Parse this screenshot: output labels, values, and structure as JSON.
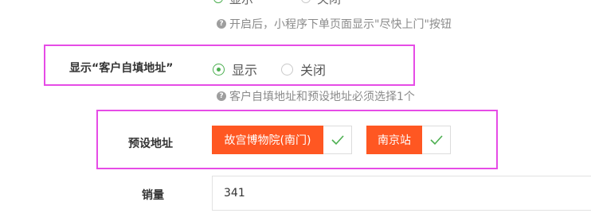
{
  "top_radios": {
    "options": [
      "显示",
      "关闭"
    ]
  },
  "hint_quick_visit": "开启后，小程序下单页面显示\"尽快上门\"按钮",
  "show_customer_address": {
    "label": "显示“客户自填地址”",
    "options": [
      {
        "label": "显示",
        "checked": true
      },
      {
        "label": "关闭",
        "checked": false
      }
    ]
  },
  "hint_address_required": "客户自填地址和预设地址必须选择1个",
  "preset_address": {
    "label": "预设地址",
    "tags": [
      {
        "label": "故宫博物院(南门)"
      },
      {
        "label": "南京站"
      }
    ]
  },
  "sales": {
    "label": "销量",
    "value": "341"
  },
  "icons": {
    "hint": "question-circle-icon",
    "check": "check-icon"
  },
  "colors": {
    "accent": "#ff5722",
    "highlight": "#e64ce6",
    "radio_checked": "#4caf50"
  }
}
